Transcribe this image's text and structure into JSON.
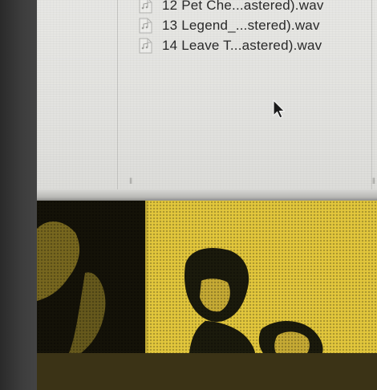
{
  "finder": {
    "files": [
      {
        "name": "12 Pet Che...astered).wav",
        "icon": "audio-file-icon"
      },
      {
        "name": "13 Legend_...stered).wav",
        "icon": "audio-file-icon"
      },
      {
        "name": "14 Leave T...astered).wav",
        "icon": "audio-file-icon"
      }
    ]
  },
  "colors": {
    "window_bg": "#e4e4e1",
    "artwork_yellow": "#e3c73c",
    "artwork_black": "#141208"
  }
}
